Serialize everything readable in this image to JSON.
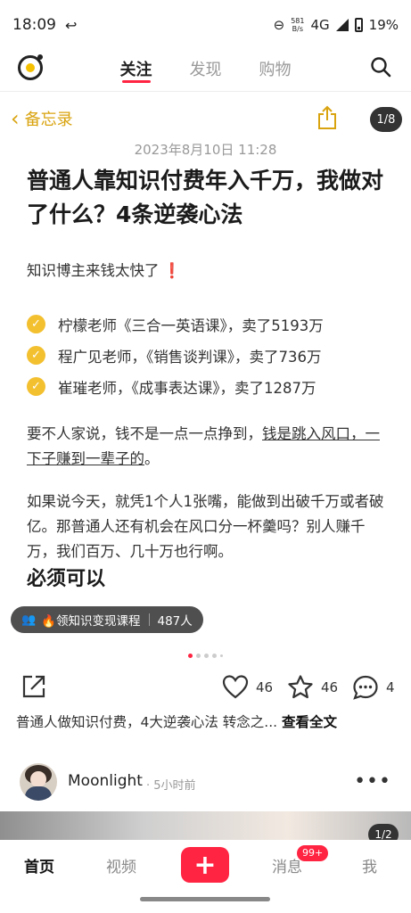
{
  "status_bar": {
    "time": "18:09",
    "net_speed_top": "581",
    "net_speed_bottom": "B/s",
    "network": "4G",
    "battery": "19%"
  },
  "top_nav": {
    "tabs": [
      {
        "label": "关注",
        "active": true
      },
      {
        "label": "发现",
        "active": false
      },
      {
        "label": "购物",
        "active": false
      }
    ]
  },
  "note_header": {
    "back_label": "备忘录",
    "pager": "1/8"
  },
  "note": {
    "date": "2023年8月10日 11:28",
    "title": "普通人靠知识付费年入千万，我做对了什么？4条逆袭心法",
    "intro": "知识博主来钱太快了",
    "intro_mark": "❗",
    "checks": [
      "柠檬老师《三合一英语课》，卖了5193万",
      "程广见老师，《销售谈判课》，卖了736万",
      "崔璀老师，《成事表达课》，卖了1287万"
    ],
    "para1_plain": "要不人家说，钱不是一点一点挣到，",
    "para1_underline": "钱是跳入风口，一下子赚到一辈子的",
    "para1_end": "。",
    "para2": "如果说今天，就凭1个人1张嘴，能做到出破千万或者破亿。那普通人还有机会在风口分一杯羹吗？别人赚千万，我们百万、几十万也行啊。",
    "para3_partial": "必须可以"
  },
  "course_pill": {
    "label": "🔥领知识变现课程",
    "count": "487人"
  },
  "carousel": {
    "current_index": 0
  },
  "actions": {
    "likes": "46",
    "favorites": "46",
    "comments": "4"
  },
  "caption": {
    "text": "普通人做知识付费，4大逆袭心法  转念之... ",
    "more": "查看全文"
  },
  "next_post": {
    "author": "Moonlight",
    "time": "· 5小时前",
    "pager": "1/2"
  },
  "bottom_nav": {
    "home": "首页",
    "video": "视频",
    "plus": "+",
    "messages": "消息",
    "messages_badge": "99+",
    "me": "我"
  },
  "colors": {
    "accent_red": "#ff2442",
    "back_gold": "#d9a30f",
    "check_yellow": "#f3c02f"
  }
}
